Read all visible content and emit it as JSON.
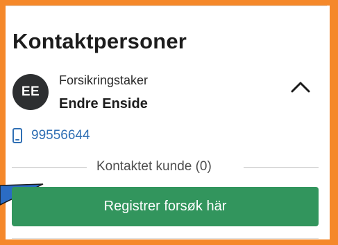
{
  "panel": {
    "title": "Kontaktpersoner"
  },
  "contact": {
    "initials": "EE",
    "role": "Forsikringstaker",
    "name": "Endre Enside",
    "expand_icon": "chevron-up-icon",
    "phone_icon": "mobile-phone-icon",
    "phone": "99556644"
  },
  "contacted": {
    "label": "Kontaktet kunde (0)"
  },
  "action": {
    "register_label": "Registrer forsøk här"
  },
  "colors": {
    "highlight_border": "#f5882a",
    "button_green": "#32955d",
    "link_blue": "#2f6fb4",
    "avatar_bg": "#2d2f31",
    "pointer_blue": "#2b6cc4"
  }
}
